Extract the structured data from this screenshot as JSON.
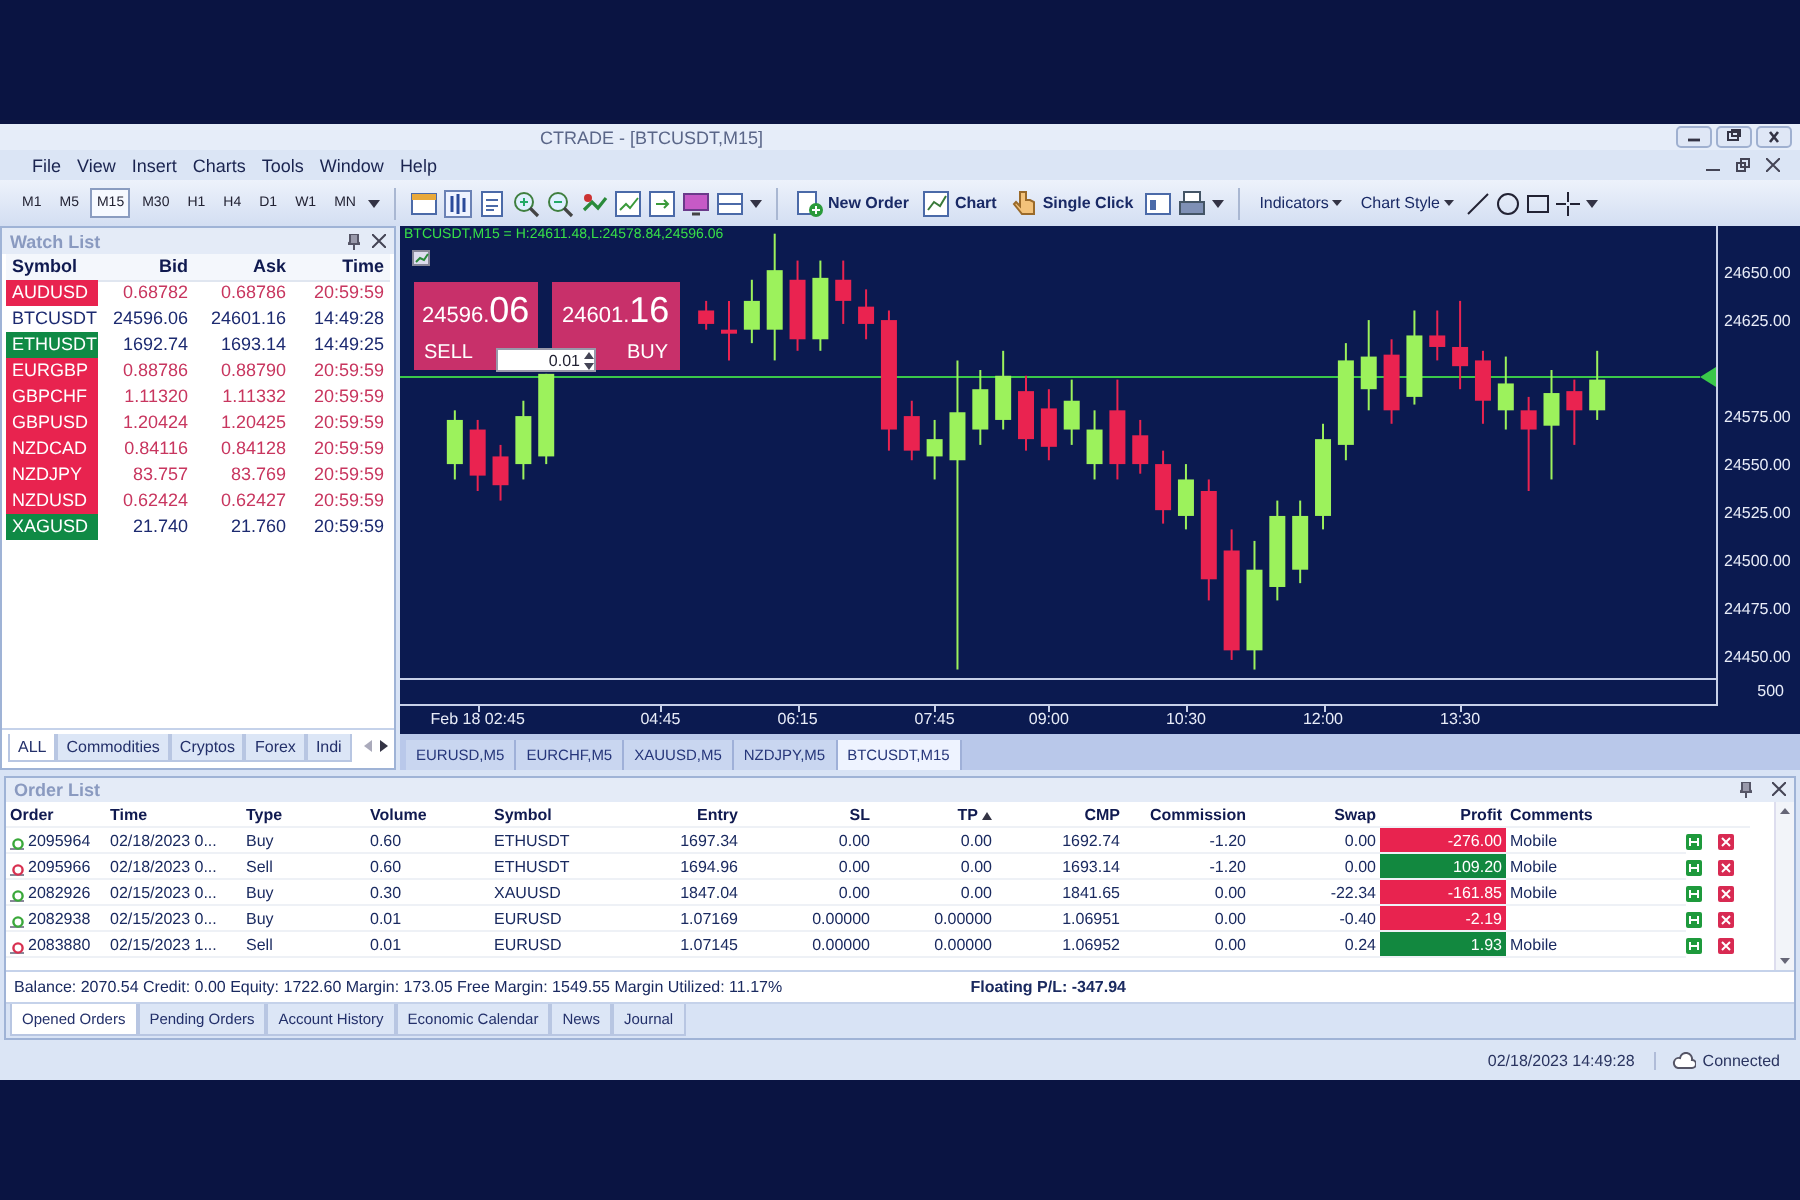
{
  "window": {
    "title": "CTRADE - [BTCUSDT,M15]"
  },
  "menu": [
    "File",
    "View",
    "Insert",
    "Charts",
    "Tools",
    "Window",
    "Help"
  ],
  "toolbar": {
    "timeframes": [
      {
        "label": "M1",
        "selected": false
      },
      {
        "label": "M5",
        "selected": false
      },
      {
        "label": "M15",
        "selected": true
      },
      {
        "label": "M30",
        "selected": false
      },
      {
        "label": "H1",
        "selected": false
      },
      {
        "label": "H4",
        "selected": false
      },
      {
        "label": "D1",
        "selected": false
      },
      {
        "label": "W1",
        "selected": false
      },
      {
        "label": "MN",
        "selected": false
      }
    ],
    "actions": [
      "New Order",
      "Chart",
      "Single Click"
    ],
    "dropdowns": [
      "Indicators",
      "Chart Style"
    ]
  },
  "watch_list": {
    "title": "Watch List",
    "columns": [
      "Symbol",
      "Bid",
      "Ask",
      "Time"
    ],
    "rows": [
      {
        "symbol": "AUDUSD",
        "bid": "0.68782",
        "ask": "0.68786",
        "time": "20:59:59",
        "color": "#e8234f",
        "down": true
      },
      {
        "symbol": "BTCUSDT",
        "bid": "24596.06",
        "ask": "24601.16",
        "time": "14:49:28",
        "down": false
      },
      {
        "symbol": "ETHUSDT",
        "bid": "1692.74",
        "ask": "1693.14",
        "time": "14:49:25",
        "color": "#0f8a45",
        "down": false
      },
      {
        "symbol": "EURGBP",
        "bid": "0.88786",
        "ask": "0.88790",
        "time": "20:59:59",
        "color": "#e8234f",
        "down": true
      },
      {
        "symbol": "GBPCHF",
        "bid": "1.11320",
        "ask": "1.11332",
        "time": "20:59:59",
        "color": "#e8234f",
        "down": true
      },
      {
        "symbol": "GBPUSD",
        "bid": "1.20424",
        "ask": "1.20425",
        "time": "20:59:59",
        "color": "#e8234f",
        "down": true
      },
      {
        "symbol": "NZDCAD",
        "bid": "0.84116",
        "ask": "0.84128",
        "time": "20:59:59",
        "color": "#e8234f",
        "down": true
      },
      {
        "symbol": "NZDJPY",
        "bid": "83.757",
        "ask": "83.769",
        "time": "20:59:59",
        "color": "#e8234f",
        "down": true
      },
      {
        "symbol": "NZDUSD",
        "bid": "0.62424",
        "ask": "0.62427",
        "time": "20:59:59",
        "color": "#e8234f",
        "down": true
      },
      {
        "symbol": "XAGUSD",
        "bid": "21.740",
        "ask": "21.760",
        "time": "20:59:59",
        "color": "#0f8a45",
        "down": false
      }
    ],
    "tabs": [
      {
        "label": "ALL",
        "selected": true
      },
      {
        "label": "Commodities",
        "selected": false
      },
      {
        "label": "Cryptos",
        "selected": false
      },
      {
        "label": "Forex",
        "selected": false
      },
      {
        "label": "Indi",
        "selected": false
      }
    ]
  },
  "chart": {
    "header": "BTCUSDT,M15 = H:24611.48,L:24578.84,24596.06",
    "sell": {
      "price": "24596.",
      "pips": "06",
      "label": "SELL"
    },
    "buy": {
      "price": "24601.",
      "pips": "16",
      "label": "BUY"
    },
    "lot": "0.01",
    "volume_label": "500",
    "chart_data": {
      "type": "candlestick",
      "x": [
        2.5,
        2.75,
        3,
        3.25,
        3.5,
        5.25,
        5.5,
        5.75,
        6,
        6.25,
        6.5,
        6.75,
        7,
        7.25,
        7.5,
        7.75,
        8,
        8.25,
        8.5,
        8.75,
        9,
        9.25,
        9.5,
        9.75,
        10,
        10.25,
        10.5,
        10.75,
        11,
        11.25,
        11.5,
        11.75,
        12,
        12.25,
        12.5,
        12.75,
        13,
        13.25,
        13.5,
        13.75,
        14,
        14.25,
        14.5,
        14.75,
        15
      ],
      "ohlc": [
        [
          24551,
          24579,
          24543,
          24574
        ],
        [
          24569,
          24574,
          24537,
          24545
        ],
        [
          24555,
          24561,
          24532,
          24540
        ],
        [
          24551,
          24584,
          24543,
          24576
        ],
        [
          24555,
          24598,
          24551,
          24598
        ],
        [
          24631,
          24636,
          24621,
          24624
        ],
        [
          24621,
          24636,
          24605,
          24619
        ],
        [
          24621,
          24647,
          24614,
          24636
        ],
        [
          24621,
          24671,
          24605,
          24652
        ],
        [
          24647,
          24657,
          24610,
          24616
        ],
        [
          24616,
          24657,
          24610,
          24648
        ],
        [
          24647,
          24657,
          24624,
          24636
        ],
        [
          24633,
          24642,
          24616,
          24624
        ],
        [
          24626,
          24631,
          24558,
          24569
        ],
        [
          24576,
          24584,
          24553,
          24558
        ],
        [
          24555,
          24574,
          24543,
          24564
        ],
        [
          24553,
          24605,
          24444,
          24578
        ],
        [
          24569,
          24600,
          24561,
          24590
        ],
        [
          24574,
          24610,
          24569,
          24597
        ],
        [
          24589,
          24597,
          24558,
          24564
        ],
        [
          24580,
          24590,
          24553,
          24560
        ],
        [
          24569,
          24595,
          24561,
          24584
        ],
        [
          24551,
          24579,
          24543,
          24569
        ],
        [
          24579,
          24595,
          24543,
          24551
        ],
        [
          24566,
          24574,
          24546,
          24551
        ],
        [
          24551,
          24558,
          24520,
          24527
        ],
        [
          24524,
          24551,
          24517,
          24543
        ],
        [
          24537,
          24543,
          24480,
          24491
        ],
        [
          24506,
          24517,
          24449,
          24454
        ],
        [
          24454,
          24511,
          24444,
          24496
        ],
        [
          24487,
          24532,
          24480,
          24524
        ],
        [
          24496,
          24532,
          24489,
          24524
        ],
        [
          24524,
          24572,
          24517,
          24564
        ],
        [
          24561,
          24614,
          24553,
          24605
        ],
        [
          24590,
          24626,
          24579,
          24607
        ],
        [
          24608,
          24616,
          24572,
          24579
        ],
        [
          24586,
          24631,
          24582,
          24618
        ],
        [
          24618,
          24631,
          24605,
          24612
        ],
        [
          24612,
          24636,
          24590,
          24602
        ],
        [
          24605,
          24610,
          24572,
          24584
        ],
        [
          24579,
          24607,
          24569,
          24593
        ],
        [
          24579,
          24586,
          24537,
          24569
        ],
        [
          24571,
          24600,
          24543,
          24588
        ],
        [
          24589,
          24595,
          24561,
          24579
        ],
        [
          24579,
          24610,
          24574,
          24595
        ]
      ],
      "xlim": [
        1.9,
        16.3
      ],
      "ylim": [
        24439.6,
        24675
      ],
      "yticks": [
        {
          "value": 24650,
          "label": "24650.00"
        },
        {
          "value": 24625,
          "label": "24625.00"
        },
        {
          "value": 24575,
          "label": "24575.00"
        },
        {
          "value": 24550,
          "label": "24550.00"
        },
        {
          "value": 24525,
          "label": "24525.00"
        },
        {
          "value": 24500,
          "label": "24500.00"
        },
        {
          "value": 24475,
          "label": "24475.00"
        },
        {
          "value": 24450,
          "label": "24450.00"
        }
      ],
      "xticks": [
        {
          "value": 2.75,
          "label": "Feb 18 02:45"
        },
        {
          "value": 4.75,
          "label": "04:45"
        },
        {
          "value": 6.25,
          "label": "06:15"
        },
        {
          "value": 7.75,
          "label": "07:45"
        },
        {
          "value": 9,
          "label": "09:00"
        },
        {
          "value": 10.5,
          "label": "10:30"
        },
        {
          "value": 12,
          "label": "12:00"
        },
        {
          "value": 13.5,
          "label": "13:30"
        }
      ]
    },
    "tabs": [
      {
        "label": "EURUSD,M5",
        "selected": false
      },
      {
        "label": "EURCHF,M5",
        "selected": false
      },
      {
        "label": "XAUUSD,M5",
        "selected": false
      },
      {
        "label": "NZDJPY,M5",
        "selected": false
      },
      {
        "label": "BTCUSDT,M15",
        "selected": true
      }
    ]
  },
  "order_list": {
    "title": "Order List",
    "columns": [
      {
        "label": "Order",
        "sorted": false
      },
      {
        "label": "Time",
        "sorted": false
      },
      {
        "label": "Type",
        "sorted": false
      },
      {
        "label": "Volume",
        "sorted": false
      },
      {
        "label": "Symbol",
        "sorted": false
      },
      {
        "label": "Entry",
        "sorted": false
      },
      {
        "label": "SL",
        "sorted": false
      },
      {
        "label": "TP",
        "sorted": true
      },
      {
        "label": "CMP",
        "sorted": false
      },
      {
        "label": "Commission",
        "sorted": false
      },
      {
        "label": "Swap",
        "sorted": false
      },
      {
        "label": "Profit",
        "sorted": false
      },
      {
        "label": "Comments",
        "sorted": false
      }
    ],
    "rows": [
      {
        "order": "2095964",
        "color": "#3aa83a",
        "time": "02/18/2023 0...",
        "type": "Buy",
        "volume": "0.60",
        "symbol": "ETHUSDT",
        "entry": "1697.34",
        "sl": "0.00",
        "tp": "0.00",
        "cmp": "1692.74",
        "commission": "-1.20",
        "swap": "0.00",
        "profit": "-276.00",
        "loss": true,
        "comments": "Mobile"
      },
      {
        "order": "2095966",
        "color": "#d83050",
        "time": "02/18/2023 0...",
        "type": "Sell",
        "volume": "0.60",
        "symbol": "ETHUSDT",
        "entry": "1694.96",
        "sl": "0.00",
        "tp": "0.00",
        "cmp": "1693.14",
        "commission": "-1.20",
        "swap": "0.00",
        "profit": "109.20",
        "loss": false,
        "comments": "Mobile"
      },
      {
        "order": "2082926",
        "color": "#3aa83a",
        "time": "02/15/2023 0...",
        "type": "Buy",
        "volume": "0.30",
        "symbol": "XAUUSD",
        "entry": "1847.04",
        "sl": "0.00",
        "tp": "0.00",
        "cmp": "1841.65",
        "commission": "0.00",
        "swap": "-22.34",
        "profit": "-161.85",
        "loss": true,
        "comments": "Mobile"
      },
      {
        "order": "2082938",
        "color": "#3aa83a",
        "time": "02/15/2023 0...",
        "type": "Buy",
        "volume": "0.01",
        "symbol": "EURUSD",
        "entry": "1.07169",
        "sl": "0.00000",
        "tp": "0.00000",
        "cmp": "1.06951",
        "commission": "0.00",
        "swap": "-0.40",
        "profit": "-2.19",
        "loss": true
      },
      {
        "order": "2083880",
        "color": "#d83050",
        "time": "02/15/2023 1...",
        "type": "Sell",
        "volume": "0.01",
        "symbol": "EURUSD",
        "entry": "1.07145",
        "sl": "0.00000",
        "tp": "0.00000",
        "cmp": "1.06952",
        "commission": "0.00",
        "swap": "0.24",
        "profit": "1.93",
        "loss": false,
        "comments": "Mobile"
      }
    ],
    "summary": "Balance: 2070.54 Credit: 0.00 Equity: 1722.60 Margin: 173.05 Free Margin: 1549.55 Margin Utilized: 11.17%",
    "floating": "Floating P/L: -347.94",
    "tabs": [
      {
        "label": "Opened Orders",
        "selected": true
      },
      {
        "label": "Pending Orders",
        "selected": false
      },
      {
        "label": "Account History",
        "selected": false
      },
      {
        "label": "Economic Calendar",
        "selected": false
      },
      {
        "label": "News",
        "selected": false
      },
      {
        "label": "Journal",
        "selected": false
      }
    ]
  },
  "status_bar": {
    "time": "02/18/2023 14:49:28",
    "connection": "Connected"
  }
}
